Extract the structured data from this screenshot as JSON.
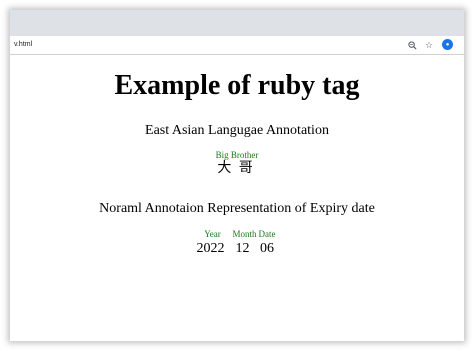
{
  "browser": {
    "url": "v.html"
  },
  "page": {
    "heading": "Example of ruby tag",
    "section1_title": "East Asian Langugae Annotation",
    "ruby1": {
      "annotation": "Big Brother",
      "chars": [
        "大",
        "哥"
      ]
    },
    "section2_title": "Noraml Annotaion Representation of Expiry date",
    "ruby2": [
      {
        "base": "2022",
        "annotation": "Year"
      },
      {
        "base": "12",
        "annotation": "Month"
      },
      {
        "base": "06",
        "annotation": "Date"
      }
    ]
  },
  "icons": {
    "zoom": "zoom-icon",
    "star": "bookmark-star-icon",
    "profile": "profile-icon"
  }
}
